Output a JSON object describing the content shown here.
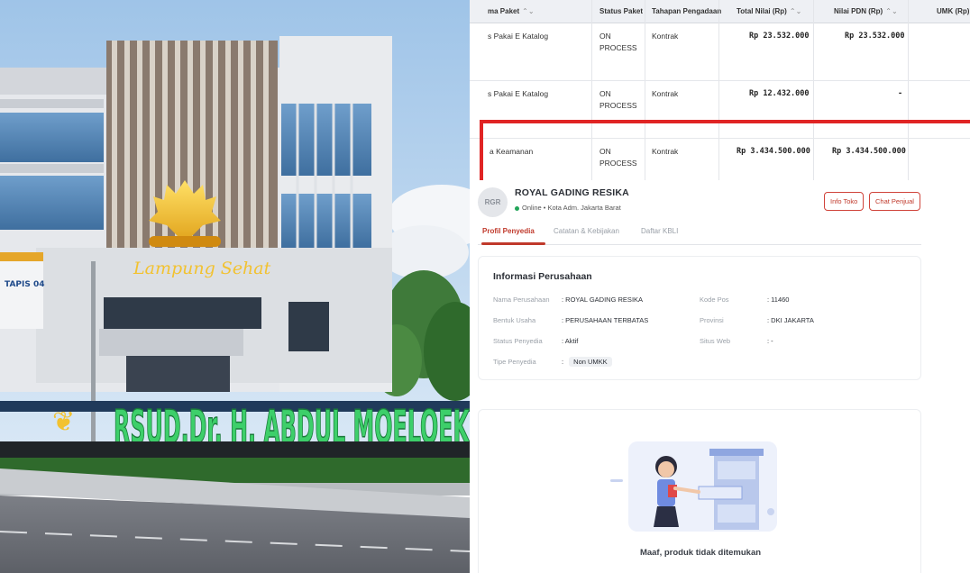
{
  "photo": {
    "signage": {
      "logo_text": "Lampung Sehat",
      "hospital_name": "RSUD.Dr. H. ABDUL MOELOEK",
      "side_sign": "TAPIS 04"
    }
  },
  "table": {
    "columns": [
      {
        "label": "ma Paket",
        "sortable": true
      },
      {
        "label": "Status Paket",
        "sortable": false
      },
      {
        "label": "Tahapan Pengadaan",
        "sortable": false
      },
      {
        "label": "Total Nilai (Rp)",
        "sortable": true
      },
      {
        "label": "Nilai PDN (Rp)",
        "sortable": true
      },
      {
        "label": "UMK (Rp)",
        "sortable": false
      }
    ],
    "sort_icon": "⌃⌄",
    "rows": [
      {
        "nama": "s Pakai E Katalog",
        "status_line1": "ON",
        "status_line2": "PROCESS",
        "tahapan": "Kontrak",
        "total": "Rp 23.532.000",
        "pdn": "Rp 23.532.000"
      },
      {
        "nama": "s Pakai E Katalog",
        "status_line1": "ON",
        "status_line2": "PROCESS",
        "tahapan": "Kontrak",
        "total": "Rp 12.432.000",
        "pdn": "-"
      },
      {
        "nama": "a Keamanan",
        "status_line1": "ON",
        "status_line2": "PROCESS",
        "tahapan": "Kontrak",
        "total": "Rp 3.434.500.000",
        "pdn": "Rp 3.434.500.000"
      }
    ],
    "highlight_color": "#e02424"
  },
  "vendor": {
    "avatar_initials": "RGR",
    "name": "ROYAL GADING RESIKA",
    "online": "Online",
    "location": "Kota Adm. Jakarta Barat",
    "buttons": {
      "info": "Info Toko",
      "chat": "Chat Penjual"
    },
    "tabs": [
      "Profil Penyedia",
      "Catatan & Kebijakan",
      "Daftar KBLI"
    ],
    "info": {
      "title": "Informasi Perusahaan",
      "fields_left": [
        {
          "label": "Nama Perusahaan",
          "value": "ROYAL GADING RESIKA"
        },
        {
          "label": "Bentuk Usaha",
          "value": "PERUSAHAAN TERBATAS"
        },
        {
          "label": "Status Penyedia",
          "value": "Aktif"
        },
        {
          "label": "Tipe Penyedia",
          "value": "Non UMKK"
        }
      ],
      "fields_right": [
        {
          "label": "Kode Pos",
          "value": "11460"
        },
        {
          "label": "Provinsi",
          "value": "DKI JAKARTA"
        },
        {
          "label": "Situs Web",
          "value": "-"
        }
      ]
    },
    "empty_message": "Maaf, produk tidak ditemukan",
    "accent_color": "#c0392b"
  }
}
